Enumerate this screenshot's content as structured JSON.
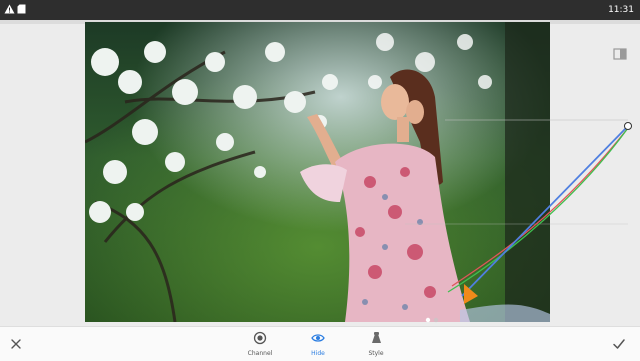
{
  "status_bar": {
    "time": "11:31",
    "left_icons": [
      "warning-icon",
      "sd-card-icon"
    ]
  },
  "toolbar": {
    "cancel_icon": "close-icon",
    "apply_icon": "checkmark-icon",
    "tools": [
      {
        "label": "Channel",
        "icon": "channel-icon",
        "active": false
      },
      {
        "label": "Hide",
        "icon": "eye-icon",
        "active": true
      },
      {
        "label": "Style",
        "icon": "style-icon",
        "active": false
      }
    ]
  },
  "colors": {
    "accent": "#2b7de1",
    "status_bar": "#2e2e2e",
    "bottom_bar": "#fafafa",
    "canvas_bg": "#ececec",
    "curve_rgb": "#4f7fe0",
    "curve_red": "#e0555a",
    "curve_green": "#3fbf4f"
  }
}
